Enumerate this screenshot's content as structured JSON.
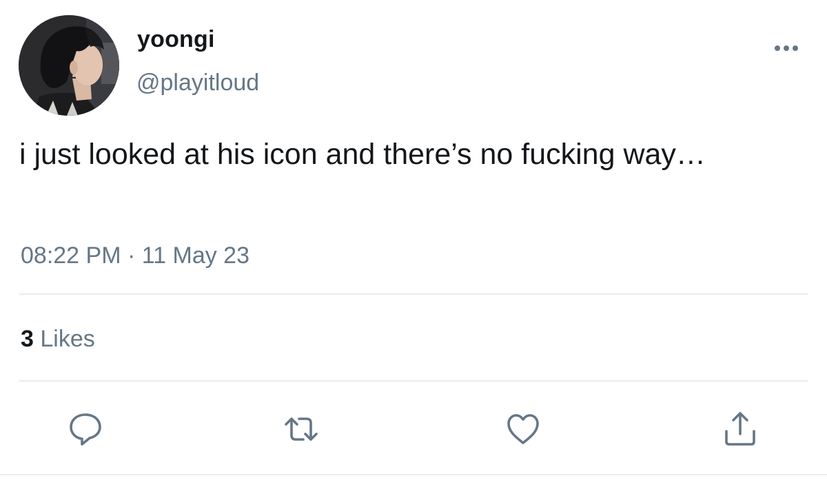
{
  "user": {
    "display_name": "yoongi",
    "handle": "@playitloud",
    "avatar_icon": "profile-photo"
  },
  "tweet": {
    "text": "i just looked at his icon and there’s no fucking way…",
    "time": "08:22 PM",
    "separator": "·",
    "date": "11 May 23"
  },
  "stats": {
    "likes_count": "3",
    "likes_label": "Likes"
  },
  "actions": [
    {
      "name": "reply",
      "icon": "comment-icon"
    },
    {
      "name": "retweet",
      "icon": "retweet-icon"
    },
    {
      "name": "like",
      "icon": "heart-icon"
    },
    {
      "name": "share",
      "icon": "share-icon"
    }
  ],
  "colors": {
    "text_primary": "#14171a",
    "text_secondary": "#657786",
    "icon": "#657786",
    "divider": "#e6ecf0"
  }
}
